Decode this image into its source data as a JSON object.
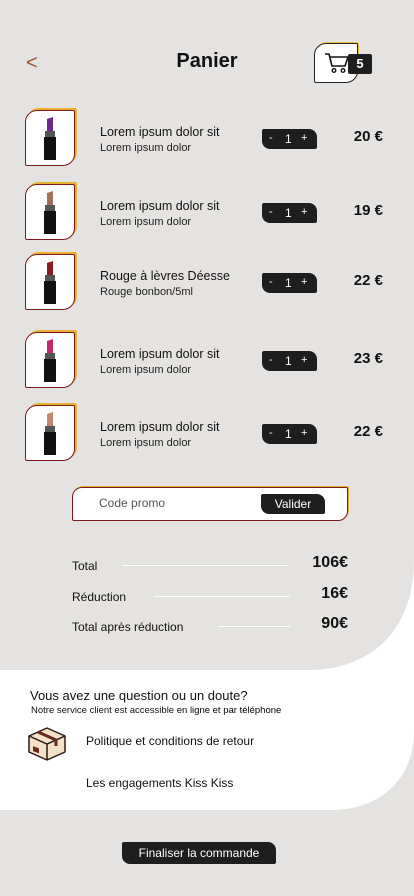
{
  "header": {
    "title": "Panier",
    "back_symbol": "<",
    "cart_count": "5"
  },
  "items": [
    {
      "name": "Lorem ipsum dolor sit",
      "sub": "Lorem ipsum dolor",
      "qty": "1",
      "price": "20 €",
      "color": "#6a2c8a"
    },
    {
      "name": "Lorem ipsum dolor sit",
      "sub": "Lorem ipsum dolor",
      "qty": "1",
      "price": "19 €",
      "color": "#a0705a"
    },
    {
      "name": "Rouge à lèvres Déesse",
      "sub": "Rouge bonbon/5ml",
      "qty": "1",
      "price": "22 €",
      "color": "#8a1c22"
    },
    {
      "name": "Lorem ipsum dolor sit",
      "sub": "Lorem ipsum dolor",
      "qty": "1",
      "price": "23 €",
      "color": "#c0286a"
    },
    {
      "name": "Lorem ipsum dolor sit",
      "sub": "Lorem ipsum dolor",
      "qty": "1",
      "price": "22 €",
      "color": "#c08a6e"
    }
  ],
  "stepper": {
    "minus": "-",
    "plus": "+"
  },
  "promo": {
    "placeholder": "Code promo",
    "button": "Valider"
  },
  "totals": [
    {
      "label": "Total",
      "value": "106€"
    },
    {
      "label": "Réduction",
      "value": "16€"
    },
    {
      "label": "Total après réduction",
      "value": "90€"
    }
  ],
  "support": {
    "title": "Vous avez une question ou un doute?",
    "sub_prefix": "Notre service client est accessible ",
    "sub_bold": "en ligne et par téléphone",
    "link_returns": "Politique et conditions de retour",
    "link_commitments": "Les engagements Kiss Kiss"
  },
  "checkout": {
    "label": "Finaliser la commande"
  },
  "colors": {
    "background": "#e4e3e1",
    "dark": "#1e1e1e",
    "accent_gold": "#e8b030",
    "accent_burgundy": "#7a1a1a"
  }
}
